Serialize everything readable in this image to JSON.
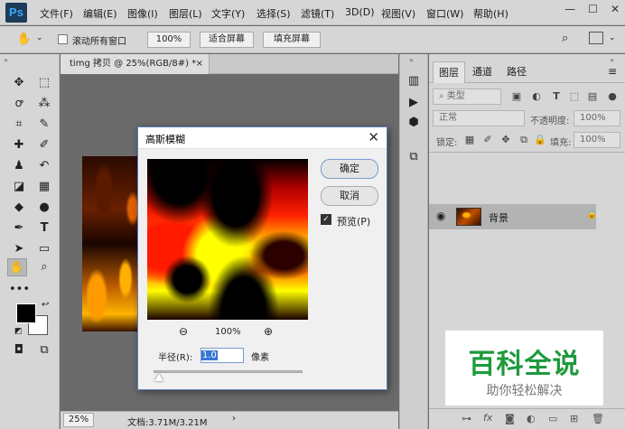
{
  "app": {
    "logo": "Ps"
  },
  "menu": {
    "items": [
      "文件(F)",
      "编辑(E)",
      "图像(I)",
      "图层(L)",
      "文字(Y)",
      "选择(S)",
      "滤镜(T)",
      "3D(D)",
      "视图(V)",
      "窗口(W)",
      "帮助(H)"
    ]
  },
  "window_controls": {
    "minimize": "—",
    "maximize": "☐",
    "close": "✕"
  },
  "options_bar": {
    "scroll_all_label": "滚动所有窗口",
    "zoom_value": "100%",
    "fit_screen": "适合屏幕",
    "fill_screen": "填充屏幕"
  },
  "document": {
    "tab_title": "timg 拷贝 @ 25%(RGB/8#) *",
    "tab_close": "×",
    "zoom": "25%",
    "doc_info": "文档:3.71M/3.21M",
    "status_arrow": "›"
  },
  "layers_panel": {
    "tabs": [
      "图层",
      "通道",
      "路径"
    ],
    "filter_kind": "类型",
    "blend_mode": "正常",
    "opacity_label": "不透明度:",
    "opacity_value": "100%",
    "lock_label": "锁定:",
    "fill_label": "填充:",
    "fill_value": "100%",
    "layer": {
      "name": "背景"
    },
    "bottom_icons": [
      "link",
      "fx",
      "mask",
      "adjustment",
      "group",
      "new-layer",
      "delete"
    ]
  },
  "dialog": {
    "title": "高斯模糊",
    "ok_label": "确定",
    "cancel_label": "取消",
    "preview_label": "预览(P)",
    "preview_checked": true,
    "zoom_level": "100%",
    "radius_label": "半径(R):",
    "radius_value": "1.0",
    "unit_label": "像素"
  },
  "watermark": {
    "title": "百科全说",
    "subtitle": "助你轻松解决"
  }
}
